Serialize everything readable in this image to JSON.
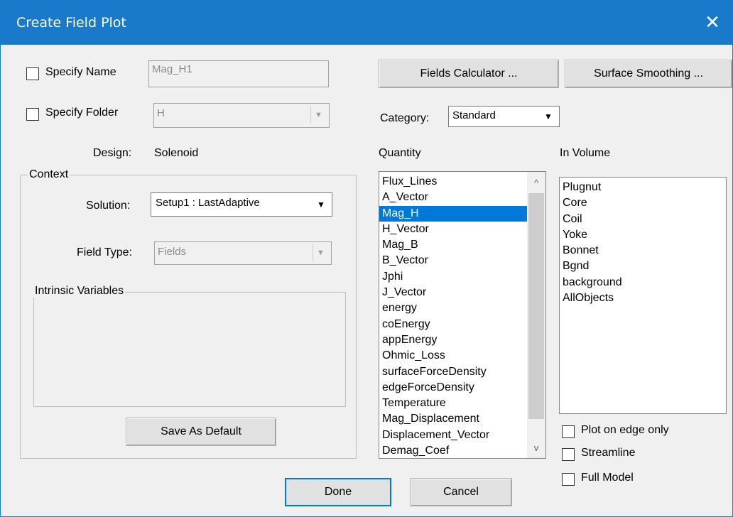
{
  "window": {
    "title": "Create Field Plot",
    "close_glyph": "✕"
  },
  "specify_name": {
    "label": "Specify Name",
    "value": "Mag_H1",
    "checked": false
  },
  "specify_folder": {
    "label": "Specify Folder",
    "value": "H",
    "checked": false
  },
  "buttons": {
    "fields_calculator": "Fields Calculator ...",
    "surface_smoothing": "Surface Smoothing ...",
    "save_as_default": "Save As Default",
    "done": "Done",
    "cancel": "Cancel"
  },
  "category": {
    "label": "Category:",
    "value": "Standard"
  },
  "design": {
    "label": "Design:",
    "value": "Solenoid"
  },
  "context": {
    "title": "Context",
    "solution_label": "Solution:",
    "solution_value": "Setup1 : LastAdaptive",
    "field_type_label": "Field Type:",
    "field_type_value": "Fields",
    "intrinsic_title": "Intrinsic Variables"
  },
  "quantity": {
    "label": "Quantity",
    "items": [
      "Flux_Lines",
      "A_Vector",
      "Mag_H",
      "H_Vector",
      "Mag_B",
      "B_Vector",
      "Jphi",
      "J_Vector",
      "energy",
      "coEnergy",
      "appEnergy",
      "Ohmic_Loss",
      "surfaceForceDensity",
      "edgeForceDensity",
      "Temperature",
      "Mag_Displacement",
      "Displacement_Vector",
      "Demag_Coef"
    ],
    "selected": "Mag_H"
  },
  "in_volume": {
    "label": "In Volume",
    "items": [
      "Plugnut",
      "Core",
      "Coil",
      "Yoke",
      "Bonnet",
      "Bgnd",
      "background",
      "AllObjects"
    ]
  },
  "options": {
    "plot_on_edge_only": "Plot on edge only",
    "streamline": "Streamline",
    "full_model": "Full Model"
  },
  "icons": {
    "dropdown": "▼",
    "scroll_up": "^",
    "scroll_down": "v"
  },
  "colors": {
    "titlebar": "#1979ca",
    "selection": "#0078d7",
    "dialog_bg": "#f0f0f0"
  }
}
